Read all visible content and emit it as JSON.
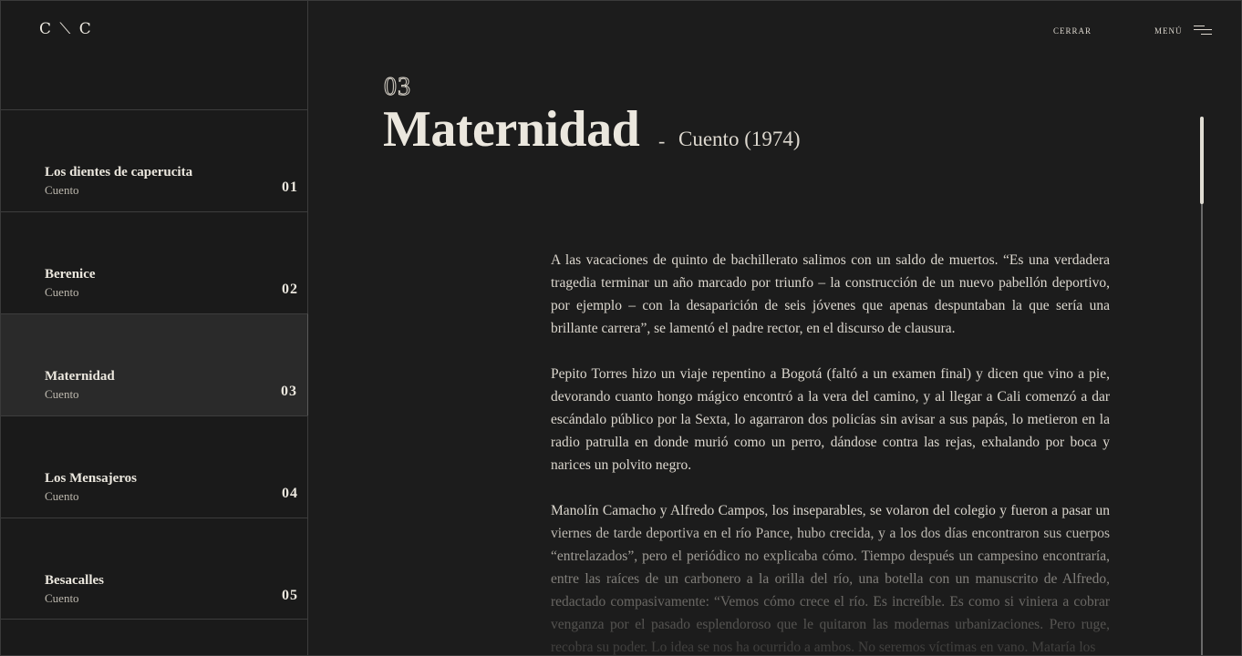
{
  "logo": "C ⟍ C",
  "nav": {
    "close_label": "CERRAR",
    "menu_label": "MENÚ",
    "menu_icon": "hamburger-icon"
  },
  "sidebar": {
    "items": [
      {
        "title": "Los dientes de caperucita",
        "subtitle": "Cuento",
        "number": "01"
      },
      {
        "title": "Berenice",
        "subtitle": "Cuento",
        "number": "02"
      },
      {
        "title": "Maternidad",
        "subtitle": "Cuento",
        "number": "03"
      },
      {
        "title": "Los Mensajeros",
        "subtitle": "Cuento",
        "number": "04"
      },
      {
        "title": "Besacalles",
        "subtitle": "Cuento",
        "number": "05"
      }
    ],
    "active_index": 2
  },
  "story": {
    "number": "03",
    "title": "Maternidad",
    "separator": "-",
    "subtitle": "Cuento (1974)",
    "paragraphs": [
      "A las vacaciones de quinto de bachillerato salimos con un saldo de muertos. “Es una verdadera tragedia terminar un año marcado por triunfo – la construcción de un nuevo pabellón deportivo, por ejemplo – con la desaparición de seis jóvenes que apenas despuntaban la que sería una brillante carrera”, se lamentó el padre rector, en el discurso de clausura.",
      "Pepito Torres hizo un viaje repentino a Bogotá (faltó a un examen final) y dicen que vino a pie, devorando cuanto hongo mágico encontró a la vera del camino, y al llegar a Cali comenzó a dar escándalo público por la Sexta, lo agarraron dos policías sin avisar a sus papás, lo metieron en la radio patrulla en donde murió como un perro, dándose contra las rejas, exhalando por boca y narices un polvito negro.",
      "Manolín Camacho y Alfredo Campos, los inseparables, se volaron del colegio y fueron a pasar un viernes de tarde deportiva en el río Pance, hubo crecida, y a los dos días encontraron sus cuerpos “entrelazados”, pero el periódico no explicaba cómo. Tiempo después un campesino encontraría, entre las raíces de un carbonero a la orilla del río, una botella con un manuscrito de Alfredo, redactado compasivamente: “Vemos cómo crece el río. Es increíble. Es como si viniera a cobrar venganza por el pasado esplendoroso que le quitaron las modernas urbanizaciones. Pero ruge, recobra su poder. Lo idea se nos ha ocurrido a ambos. No seremos víctimas en vano. Mataría los"
    ]
  },
  "colors": {
    "background": "#1c1c1c",
    "sidebar_active": "#2a2a2a",
    "text": "#e6e2da",
    "divider": "#3d3d3d"
  }
}
